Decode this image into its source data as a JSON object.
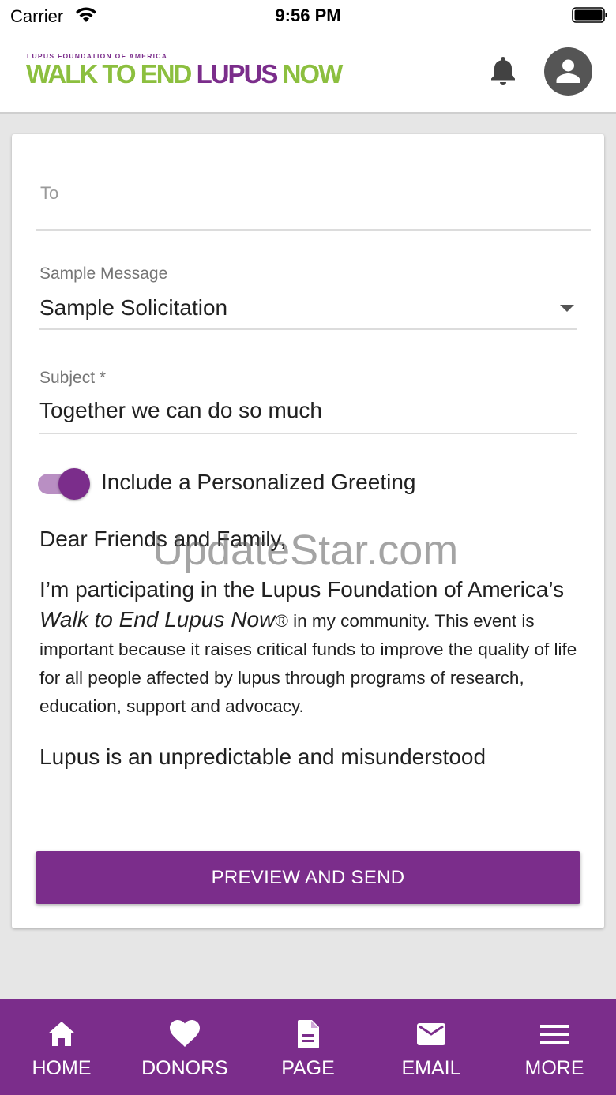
{
  "status_bar": {
    "carrier": "Carrier",
    "time": "9:56 PM"
  },
  "header": {
    "logo_subtitle": "LUPUS FOUNDATION OF AMERICA",
    "logo_walk": "WALK TO END ",
    "logo_lupus": "LUPUS",
    "logo_now": " NOW",
    "icons": [
      "bell-icon",
      "account-icon"
    ]
  },
  "form": {
    "to_placeholder": "To",
    "sample_label": "Sample Message",
    "sample_value": "Sample Solicitation",
    "subject_label": "Subject *",
    "subject_value": "Together we can do so much",
    "toggle_label": "Include a Personalized Greeting",
    "toggle_on": true,
    "greeting": "Dear Friends and Family,",
    "para1_a": "I’m participating in the Lupus Foundation of America’s ",
    "para1_italic": "Walk to End Lupus Now",
    "para1_b": "® in my community. This event is important because it raises critical funds to improve the quality of life for all people affected by lupus through programs of research, education, support and advocacy.",
    "para2": "Lupus is an unpredictable and misunderstood",
    "preview_button": "PREVIEW AND SEND"
  },
  "watermark": "UpdateStar.com",
  "bottom_nav": {
    "items": [
      {
        "label": "HOME",
        "icon": "home-icon"
      },
      {
        "label": "DONORS",
        "icon": "heart-icon"
      },
      {
        "label": "PAGE",
        "icon": "page-icon"
      },
      {
        "label": "EMAIL",
        "icon": "email-icon"
      },
      {
        "label": "MORE",
        "icon": "menu-icon"
      }
    ]
  },
  "colors": {
    "brand_purple": "#7b2d8b",
    "brand_green": "#8cbf3f"
  }
}
